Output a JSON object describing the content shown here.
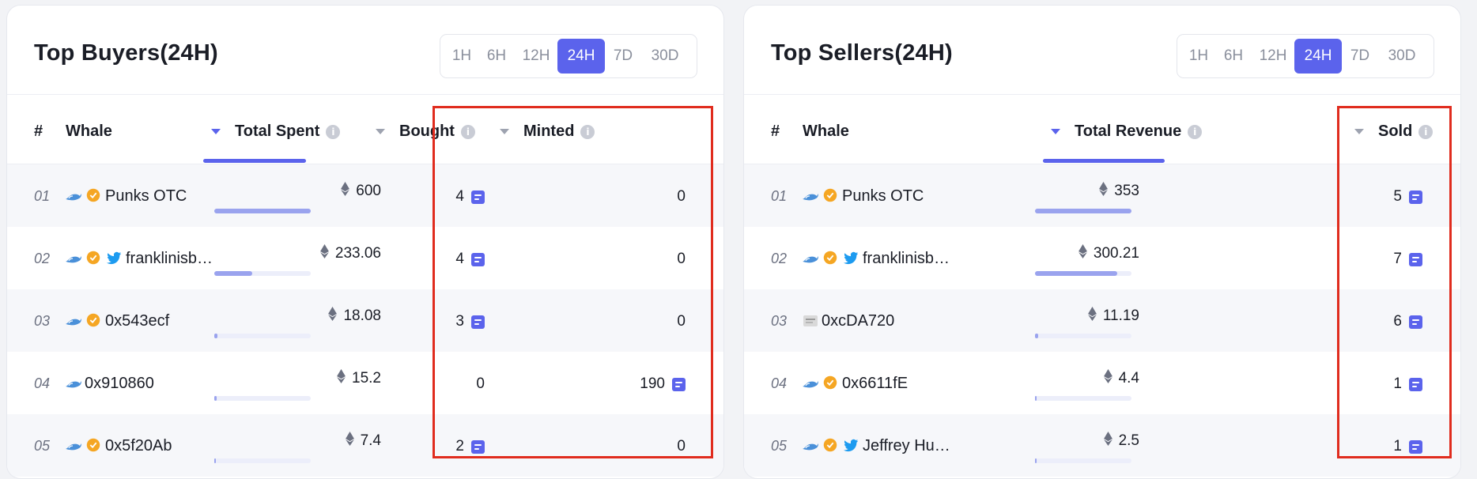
{
  "buyers": {
    "title": "Top Buyers(24H)",
    "tabs": [
      "1H",
      "6H",
      "12H",
      "24H",
      "7D",
      "30D"
    ],
    "active_tab": "24H",
    "columns": {
      "rank": "#",
      "whale": "Whale",
      "total": "Total Spent",
      "bought": "Bought",
      "minted": "Minted"
    },
    "rows": [
      {
        "rank": "01",
        "name": "Punks OTC",
        "icons": [
          "whale-icon",
          "verified-badge-icon"
        ],
        "amount": "600",
        "progress": 1.0,
        "bought": "4",
        "bought_doc": true,
        "minted": "0",
        "minted_doc": false
      },
      {
        "rank": "02",
        "name": "franklinisb…",
        "icons": [
          "whale-icon",
          "verified-badge-icon",
          "twitter-icon"
        ],
        "amount": "233.06",
        "progress": 0.39,
        "bought": "4",
        "bought_doc": true,
        "minted": "0",
        "minted_doc": false
      },
      {
        "rank": "03",
        "name": "0x543ecf",
        "icons": [
          "whale-icon",
          "verified-badge-icon"
        ],
        "amount": "18.08",
        "progress": 0.03,
        "bought": "3",
        "bought_doc": true,
        "minted": "0",
        "minted_doc": false
      },
      {
        "rank": "04",
        "name": "0x910860",
        "icons": [
          "whale-icon"
        ],
        "amount": "15.2",
        "progress": 0.025,
        "bought": "0",
        "bought_doc": false,
        "minted": "190",
        "minted_doc": true
      },
      {
        "rank": "05",
        "name": "0x5f20Ab",
        "icons": [
          "whale-icon",
          "verified-badge-icon"
        ],
        "amount": "7.4",
        "progress": 0.012,
        "bought": "2",
        "bought_doc": true,
        "minted": "0",
        "minted_doc": false
      }
    ]
  },
  "sellers": {
    "title": "Top Sellers(24H)",
    "tabs": [
      "1H",
      "6H",
      "12H",
      "24H",
      "7D",
      "30D"
    ],
    "active_tab": "24H",
    "columns": {
      "rank": "#",
      "whale": "Whale",
      "total": "Total Revenue",
      "sold": "Sold"
    },
    "rows": [
      {
        "rank": "01",
        "name": "Punks OTC",
        "icons": [
          "whale-icon",
          "verified-badge-icon"
        ],
        "amount": "353",
        "progress": 1.0,
        "sold": "5"
      },
      {
        "rank": "02",
        "name": "franklinisb…",
        "icons": [
          "whale-icon",
          "verified-badge-icon",
          "twitter-icon"
        ],
        "amount": "300.21",
        "progress": 0.85,
        "sold": "7"
      },
      {
        "rank": "03",
        "name": "0xcDA720",
        "icons": [
          "nft-avatar-icon"
        ],
        "amount": "11.19",
        "progress": 0.032,
        "sold": "6"
      },
      {
        "rank": "04",
        "name": "0x6611fE",
        "icons": [
          "whale-icon",
          "verified-badge-icon"
        ],
        "amount": "4.4",
        "progress": 0.012,
        "sold": "1"
      },
      {
        "rank": "05",
        "name": "Jeffrey Hu…",
        "icons": [
          "whale-icon",
          "verified-badge-icon",
          "twitter-icon"
        ],
        "amount": "2.5",
        "progress": 0.007,
        "sold": "1"
      }
    ]
  },
  "colors": {
    "accent": "#5b63ec",
    "highlight": "#e02c1e",
    "bar_fill": "#9aa3ee",
    "bar_track": "#eceefa",
    "whale": "#4a90d9",
    "badge": "#f5a623",
    "twitter": "#1d9bf0"
  }
}
